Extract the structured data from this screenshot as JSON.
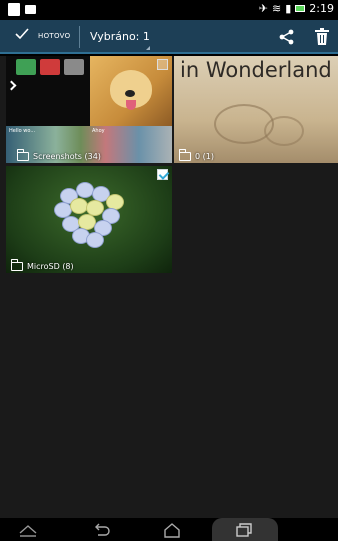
{
  "status_bar": {
    "time": "2:19"
  },
  "action_bar": {
    "done_label": "HOTOVO",
    "selected_label": "Vybráno: 1",
    "accent_color": "#1d3f56"
  },
  "albums": [
    {
      "label": "Screenshots (34)",
      "tiny_caption_1": "Hello wo...",
      "tiny_caption_2": "Ahoy"
    },
    {
      "label": "0 (1)",
      "image_text": "in Wonderland"
    },
    {
      "label": "MicroSD (8)",
      "selected": true
    }
  ],
  "nav_bar": {
    "buttons": [
      "collapse-icon",
      "back-icon",
      "home-icon",
      "recents-icon"
    ]
  }
}
